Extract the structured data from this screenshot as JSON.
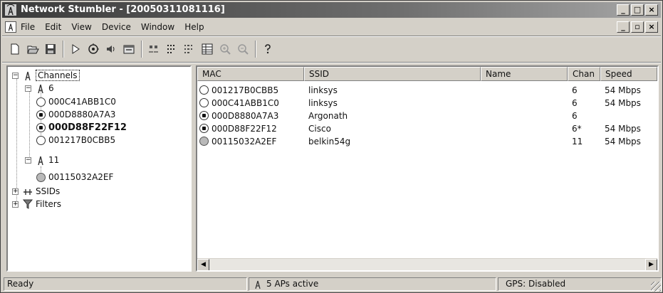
{
  "window": {
    "title": "Network Stumbler - [20050311081116]",
    "title_buttons": [
      "_",
      "□",
      "×"
    ]
  },
  "menu": {
    "items": [
      "File",
      "Edit",
      "View",
      "Device",
      "Window",
      "Help"
    ],
    "mdi_buttons": [
      "_",
      "▫",
      "×"
    ]
  },
  "toolbar": {
    "tools": [
      "new-icon",
      "open-icon",
      "save-icon",
      "play-icon",
      "scan-icon",
      "speaker-icon",
      "properties-icon",
      "large-icons-icon",
      "small-icons-icon",
      "list-view-icon",
      "details-view-icon",
      "zoom-in-icon",
      "zoom-out-icon",
      "help-icon"
    ]
  },
  "tree": {
    "root": "Channels",
    "channel_6": "6",
    "ch6_items": [
      {
        "mac": "000C41ABB1C0",
        "icon": "open"
      },
      {
        "mac": "000D8880A7A3",
        "icon": "lock"
      },
      {
        "mac": "000D88F22F12",
        "icon": "lock",
        "bold": true
      },
      {
        "mac": "001217B0CBB5",
        "icon": "open"
      }
    ],
    "channel_11": "11",
    "ch11_items": [
      {
        "mac": "00115032A2EF",
        "icon": "gray"
      }
    ],
    "ssids": "SSIDs",
    "filters": "Filters"
  },
  "list": {
    "columns": [
      "MAC",
      "SSID",
      "Name",
      "Chan",
      "Speed"
    ],
    "rows": [
      {
        "mac": "001217B0CBB5",
        "ssid": "linksys",
        "name": "",
        "chan": "6",
        "speed": "54 Mbps",
        "icon": "open"
      },
      {
        "mac": "000C41ABB1C0",
        "ssid": "linksys",
        "name": "",
        "chan": "6",
        "speed": "54 Mbps",
        "icon": "open"
      },
      {
        "mac": "000D8880A7A3",
        "ssid": "Argonath",
        "name": "",
        "chan": "6",
        "speed": "",
        "icon": "lock"
      },
      {
        "mac": "000D88F22F12",
        "ssid": "Cisco",
        "name": "",
        "chan": "6*",
        "speed": "54 Mbps",
        "icon": "lock"
      },
      {
        "mac": "00115032A2EF",
        "ssid": "belkin54g",
        "name": "",
        "chan": "11",
        "speed": "54 Mbps",
        "icon": "gray"
      }
    ]
  },
  "status": {
    "left": "Ready",
    "middle": "5 APs active",
    "right": "GPS: Disabled"
  }
}
